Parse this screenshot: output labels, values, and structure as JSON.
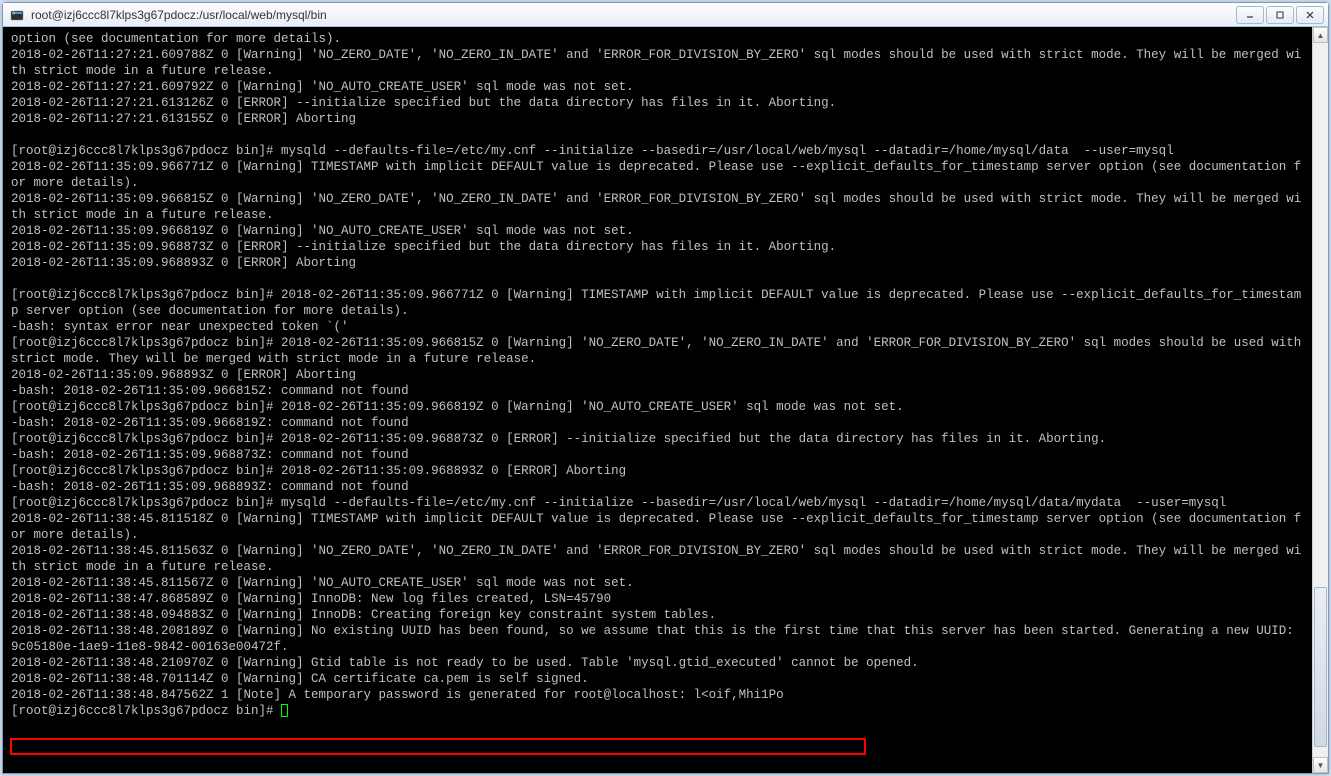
{
  "window": {
    "title": "root@izj6ccc8l7klps3g67pdocz:/usr/local/web/mysql/bin"
  },
  "terminal": {
    "lines": [
      "option (see documentation for more details).",
      "2018-02-26T11:27:21.609788Z 0 [Warning] 'NO_ZERO_DATE', 'NO_ZERO_IN_DATE' and 'ERROR_FOR_DIVISION_BY_ZERO' sql modes should be used with strict mode. They will be merged with strict mode in a future release.",
      "2018-02-26T11:27:21.609792Z 0 [Warning] 'NO_AUTO_CREATE_USER' sql mode was not set.",
      "2018-02-26T11:27:21.613126Z 0 [ERROR] --initialize specified but the data directory has files in it. Aborting.",
      "2018-02-26T11:27:21.613155Z 0 [ERROR] Aborting",
      "",
      "[root@izj6ccc8l7klps3g67pdocz bin]# mysqld --defaults-file=/etc/my.cnf --initialize --basedir=/usr/local/web/mysql --datadir=/home/mysql/data  --user=mysql",
      "2018-02-26T11:35:09.966771Z 0 [Warning] TIMESTAMP with implicit DEFAULT value is deprecated. Please use --explicit_defaults_for_timestamp server option (see documentation for more details).",
      "2018-02-26T11:35:09.966815Z 0 [Warning] 'NO_ZERO_DATE', 'NO_ZERO_IN_DATE' and 'ERROR_FOR_DIVISION_BY_ZERO' sql modes should be used with strict mode. They will be merged with strict mode in a future release.",
      "2018-02-26T11:35:09.966819Z 0 [Warning] 'NO_AUTO_CREATE_USER' sql mode was not set.",
      "2018-02-26T11:35:09.968873Z 0 [ERROR] --initialize specified but the data directory has files in it. Aborting.",
      "2018-02-26T11:35:09.968893Z 0 [ERROR] Aborting",
      "",
      "[root@izj6ccc8l7klps3g67pdocz bin]# 2018-02-26T11:35:09.966771Z 0 [Warning] TIMESTAMP with implicit DEFAULT value is deprecated. Please use --explicit_defaults_for_timestamp server option (see documentation for more details).",
      "-bash: syntax error near unexpected token `('",
      "[root@izj6ccc8l7klps3g67pdocz bin]# 2018-02-26T11:35:09.966815Z 0 [Warning] 'NO_ZERO_DATE', 'NO_ZERO_IN_DATE' and 'ERROR_FOR_DIVISION_BY_ZERO' sql modes should be used with strict mode. They will be merged with strict mode in a future release.",
      "2018-02-26T11:35:09.968893Z 0 [ERROR] Aborting",
      "-bash: 2018-02-26T11:35:09.966815Z: command not found",
      "[root@izj6ccc8l7klps3g67pdocz bin]# 2018-02-26T11:35:09.966819Z 0 [Warning] 'NO_AUTO_CREATE_USER' sql mode was not set.",
      "-bash: 2018-02-26T11:35:09.966819Z: command not found",
      "[root@izj6ccc8l7klps3g67pdocz bin]# 2018-02-26T11:35:09.968873Z 0 [ERROR] --initialize specified but the data directory has files in it. Aborting.",
      "-bash: 2018-02-26T11:35:09.968873Z: command not found",
      "[root@izj6ccc8l7klps3g67pdocz bin]# 2018-02-26T11:35:09.968893Z 0 [ERROR] Aborting",
      "-bash: 2018-02-26T11:35:09.968893Z: command not found",
      "[root@izj6ccc8l7klps3g67pdocz bin]# mysqld --defaults-file=/etc/my.cnf --initialize --basedir=/usr/local/web/mysql --datadir=/home/mysql/data/mydata  --user=mysql",
      "2018-02-26T11:38:45.811518Z 0 [Warning] TIMESTAMP with implicit DEFAULT value is deprecated. Please use --explicit_defaults_for_timestamp server option (see documentation for more details).",
      "2018-02-26T11:38:45.811563Z 0 [Warning] 'NO_ZERO_DATE', 'NO_ZERO_IN_DATE' and 'ERROR_FOR_DIVISION_BY_ZERO' sql modes should be used with strict mode. They will be merged with strict mode in a future release.",
      "2018-02-26T11:38:45.811567Z 0 [Warning] 'NO_AUTO_CREATE_USER' sql mode was not set.",
      "2018-02-26T11:38:47.868589Z 0 [Warning] InnoDB: New log files created, LSN=45790",
      "2018-02-26T11:38:48.094883Z 0 [Warning] InnoDB: Creating foreign key constraint system tables.",
      "2018-02-26T11:38:48.208189Z 0 [Warning] No existing UUID has been found, so we assume that this is the first time that this server has been started. Generating a new UUID: 9c05180e-1ae9-11e8-9842-00163e00472f.",
      "2018-02-26T11:38:48.210970Z 0 [Warning] Gtid table is not ready to be used. Table 'mysql.gtid_executed' cannot be opened.",
      "2018-02-26T11:38:48.701114Z 0 [Warning] CA certificate ca.pem is self signed.",
      "2018-02-26T11:38:48.847562Z 1 [Note] A temporary password is generated for root@localhost: l<oif,Mhi1Po"
    ],
    "prompt_final": "[root@izj6ccc8l7klps3g67pdocz bin]# "
  }
}
